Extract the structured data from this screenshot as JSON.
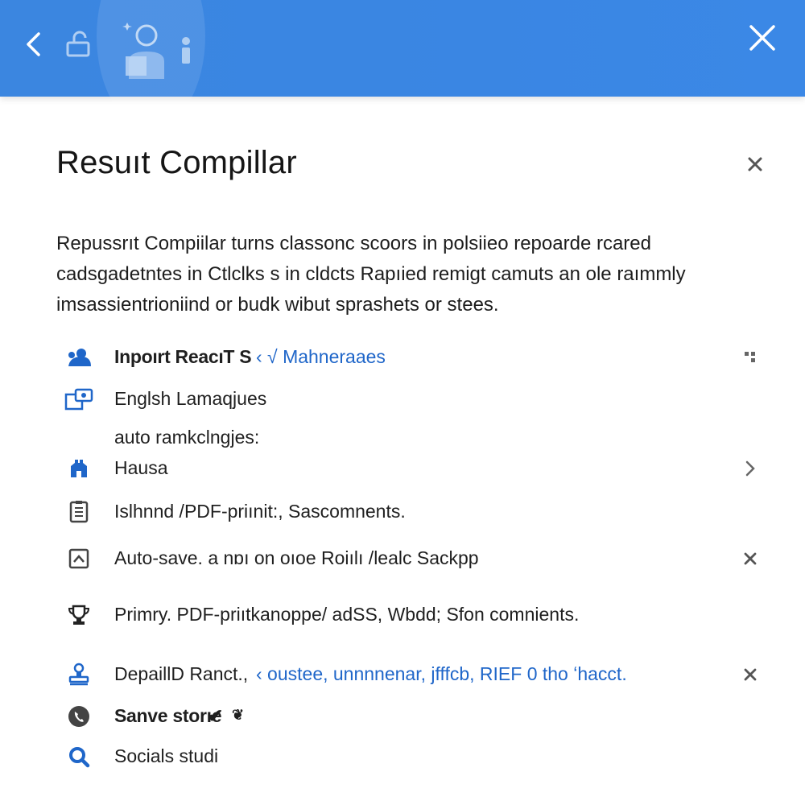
{
  "dialog": {
    "title": "Resuıt Compillar",
    "description": [
      "Repussrıt Compiilar turns classonc scoors in polsiieo repoarde rcared",
      "cadsgadetntes in Ctlclks s in cldcts Rapıied remigt camuts an ole raımmly",
      "imsassientrioniind or budk wibut sprashets or stees."
    ]
  },
  "items": [
    {
      "icon": "user-group-icon",
      "label": "Inpoırt ReacıT S",
      "extra": "‹ √ Mahneraaes",
      "trailing": "grid-icon"
    },
    {
      "icon": "language-window-icon",
      "label": "Englsh Lamaqjues",
      "sublabel": "auto ramkclngjes:"
    },
    {
      "icon": "building-icon",
      "label": "Hausa",
      "trailing": "chevron-right-icon"
    },
    {
      "icon": "document-icon",
      "label": "Islhnnd /PDF-priınit:, Sascomnents."
    },
    {
      "icon": "image-frame-icon",
      "label": "Auto-save. a nɒı on oıoe Roiılı /lealc Sackpp",
      "trailing": "close-icon"
    },
    {
      "icon": "trophy-icon",
      "label": "Primry. PDF-priıtkanoppe/ adSS, Wbdd; Sfon comnients."
    },
    {
      "icon": "stamp-icon",
      "label": "DepaillD Ranct.,",
      "extra": "‹ oustee, unnnnenar, jfffcb, RIEF  0 tho ʻhacct.",
      "trailing": "close-icon"
    },
    {
      "icon": "phone-icon",
      "label": "Sanve storıe",
      "extra": "✔",
      "extra2": "❦"
    },
    {
      "icon": "search-icon",
      "label": "Socials studi"
    }
  ],
  "colors": {
    "header": "#3b86e0",
    "accent": "#1f66c9",
    "check": "#28a77a"
  }
}
